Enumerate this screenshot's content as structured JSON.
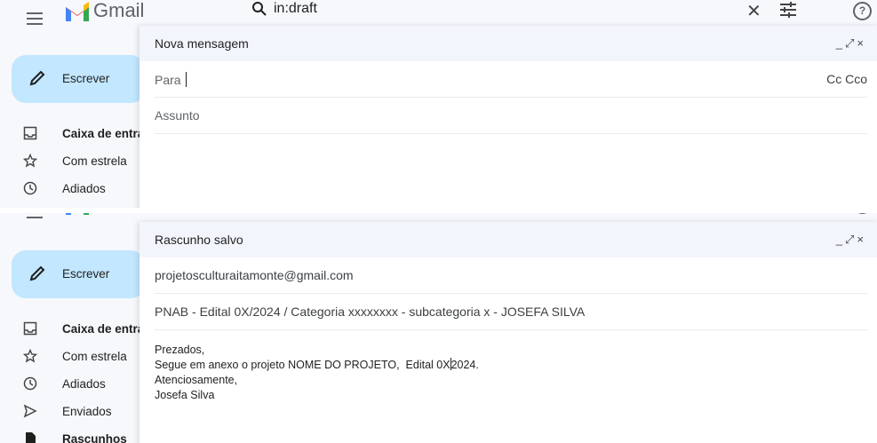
{
  "app": {
    "name": "Gmail",
    "search_query": "in:draft"
  },
  "sidebar": {
    "compose_label": "Escrever",
    "items": [
      {
        "label": "Caixa de entrada",
        "icon": "inbox-icon",
        "bold": true
      },
      {
        "label": "Com estrela",
        "icon": "star-icon",
        "bold": false
      },
      {
        "label": "Adiados",
        "icon": "clock-icon",
        "bold": false
      },
      {
        "label": "Enviados",
        "icon": "send-icon",
        "bold": false
      },
      {
        "label": "Rascunhos",
        "icon": "draft-icon",
        "bold": true
      }
    ]
  },
  "compose_new": {
    "title": "Nova mensagem",
    "to_label": "Para",
    "cc_bcc": "Cc Cco",
    "subject_placeholder": "Assunto"
  },
  "compose_saved": {
    "title": "Rascunho salvo",
    "to_value": "projetosculturaitamonte@gmail.com",
    "subject_value": "PNAB - Edital 0X/2024 / Categoria xxxxxxxx - subcategoria x - JOSEFA SILVA",
    "body_lines": [
      "Prezados,",
      "Segue em anexo o projeto NOME DO PROJETO,  Edital 0X",
      "2024.",
      "Atenciosamente,",
      "Josefa Silva"
    ]
  },
  "window_controls": {
    "minimize": "_",
    "fullscreen": "⤢",
    "close": "×"
  },
  "colors": {
    "gmail_red": "#ea4335",
    "compose_button": "#c2e7ff",
    "header_bg": "#f2f6fc",
    "app_bg": "#f6f8fc"
  }
}
